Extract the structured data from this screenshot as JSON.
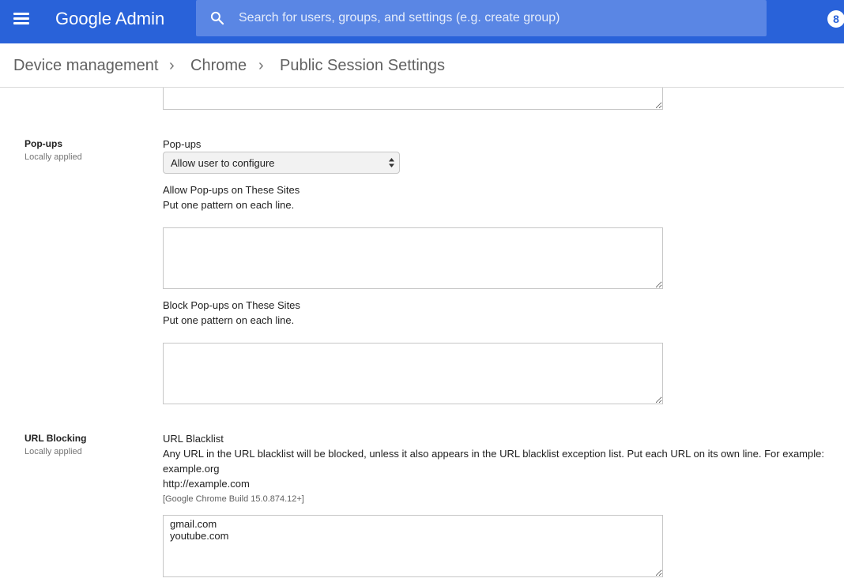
{
  "appbar": {
    "brand_google": "Google",
    "brand_product": "Admin",
    "search_placeholder": "Search for users, groups, and settings (e.g. create group)",
    "account_initial": "8"
  },
  "breadcrumb": {
    "items": [
      "Device management",
      "Chrome",
      "Public Session Settings"
    ],
    "separator": "›"
  },
  "sections": {
    "popups": {
      "title": "Pop-ups",
      "subtitle": "Locally applied",
      "select_label": "Pop-ups",
      "select_value": "Allow user to configure",
      "allow": {
        "label": "Allow Pop-ups on These Sites",
        "help": "Put one pattern on each line.",
        "value": ""
      },
      "block": {
        "label": "Block Pop-ups on These Sites",
        "help": "Put one pattern on each line.",
        "value": ""
      }
    },
    "url_blocking": {
      "title": "URL Blocking",
      "subtitle": "Locally applied",
      "field_label": "URL Blacklist",
      "description": "Any URL in the URL blacklist will be blocked, unless it also appears in the URL blacklist exception list. Put each URL on its own line. For example:",
      "example1": "example.org",
      "example2": "http://example.com",
      "note": "[Google Chrome Build 15.0.874.12+]",
      "value": "gmail.com\nyoutube.com"
    }
  },
  "colors": {
    "appbar": "#2962d9",
    "search_bg": "#5a86e4"
  }
}
